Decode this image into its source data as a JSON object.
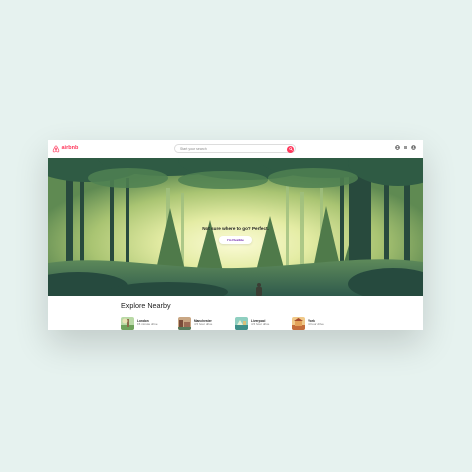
{
  "brand": {
    "name": "airbnb",
    "color": "#ff385c",
    "icon": "airbnb-logo-icon"
  },
  "search": {
    "placeholder": "Start your search",
    "button_color": "#ff385c",
    "button_icon": "search-icon"
  },
  "header_icons": [
    "globe-icon",
    "menu-icon",
    "user-avatar-icon"
  ],
  "hero": {
    "tagline": "Not sure where to go? Perfect.",
    "button_label": "I'm Flexible",
    "button_text_color": "#6a1fa8"
  },
  "explore": {
    "title": "Explore Nearby",
    "places": [
      {
        "name": "London",
        "distance": "15 minute drive"
      },
      {
        "name": "Manchester",
        "distance": "4.5 hour drive"
      },
      {
        "name": "Liverpool",
        "distance": "4.5 hour drive"
      },
      {
        "name": "York",
        "distance": "4 hour drive"
      }
    ]
  }
}
